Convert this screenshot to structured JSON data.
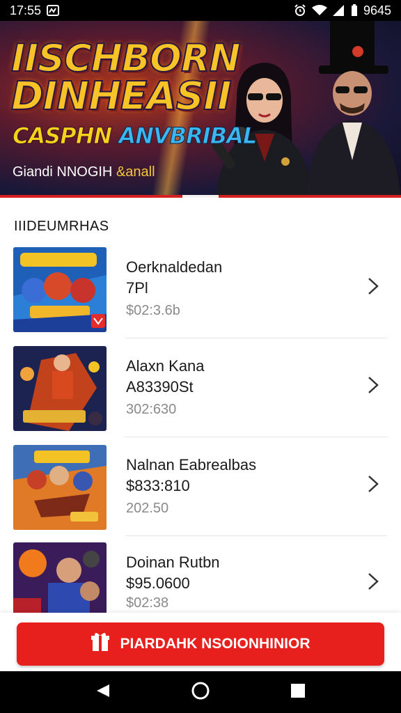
{
  "status_bar": {
    "time": "17:55",
    "battery": "9645"
  },
  "banner": {
    "title_line1": "IISCHBORN",
    "title_line2": "DINHEASII",
    "subtitle_a": "CASPHN",
    "subtitle_b": "ANVBRIBAL",
    "tagline_a": "Giandi NNOGIH",
    "tagline_b": "&anall"
  },
  "section": {
    "title": "IIIDEUMRHAS"
  },
  "items": [
    {
      "title": "Oerknaldedan",
      "subtitle": "7Pl",
      "price": "$02:3.6b"
    },
    {
      "title": "Alaxn Kana",
      "subtitle": "A83390St",
      "price": "302:630"
    },
    {
      "title": "Nalnan Eabrealbas",
      "subtitle": "$833:810",
      "price": "202.50"
    },
    {
      "title": "Doinan Rutbn",
      "subtitle": "$95.0600",
      "price": "$02:38"
    }
  ],
  "cta": {
    "label": "PIARDAHK NSOIONHINIOR"
  },
  "colors": {
    "accent": "#e8201d",
    "banner_gold": "#f7c326",
    "banner_blue": "#3ab7f0"
  },
  "icons": {
    "status": [
      "alarm-icon",
      "wifi-icon",
      "signal-icon",
      "battery-icon"
    ],
    "nav": [
      "back-icon",
      "home-icon",
      "recents-icon"
    ]
  }
}
